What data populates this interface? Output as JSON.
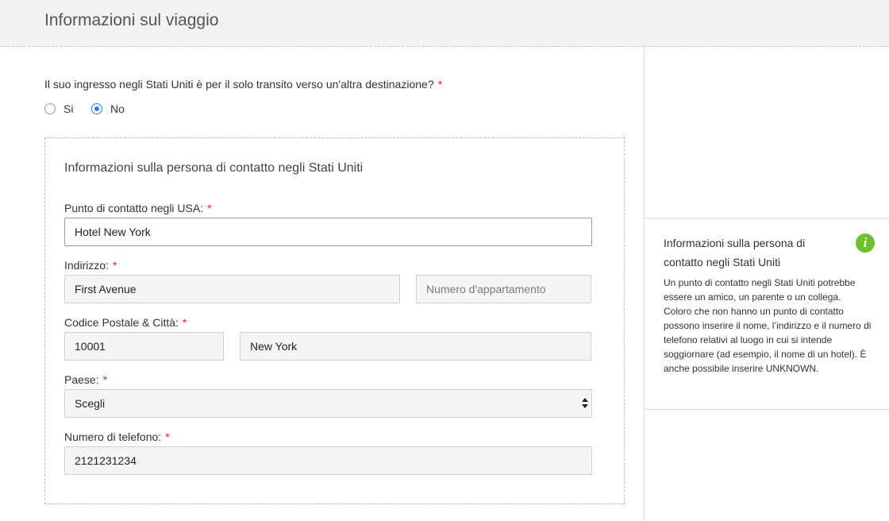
{
  "header": {
    "title": "Informazioni sul viaggio"
  },
  "transit": {
    "question": "Il suo ingresso negli Stati Uniti è per il solo transito verso un'altra destinazione?",
    "required_mark": "*",
    "options": [
      {
        "label": "Si",
        "checked": false
      },
      {
        "label": "No",
        "checked": true
      }
    ]
  },
  "contact": {
    "title": "Informazioni sulla persona di contatto negli Stati Uniti",
    "point_of_contact": {
      "label": "Punto di contatto negli USA:",
      "value": "Hotel New York"
    },
    "address": {
      "label": "Indirizzo:",
      "value": "First Avenue",
      "apartment_placeholder": "Numero d'appartamento"
    },
    "postal_city": {
      "label": "Codice Postale & Città:",
      "postal_value": "10001",
      "city_value": "New York"
    },
    "country": {
      "label": "Paese:",
      "value": "Scegli"
    },
    "phone": {
      "label": "Numero di telefono:",
      "value": "2121231234"
    }
  },
  "info_panel": {
    "title": "Informazioni sulla persona di contatto negli Stati Uniti",
    "icon": "info-icon",
    "icon_glyph": "i",
    "icon_color": "#6cc12c",
    "text": "Un punto di contatto negli Stati Uniti potrebbe essere un amico, un parente o un collega. Coloro che non hanno un punto di contatto possono inserire il nome, l’indirizzo e il numero di telefono relativi al luogo in cui si intende soggiornare (ad esempio, il nome di un hotel). È anche possibile inserire UNKNOWN."
  },
  "colors": {
    "accent": "#2f7de1",
    "required": "#e0262b"
  }
}
